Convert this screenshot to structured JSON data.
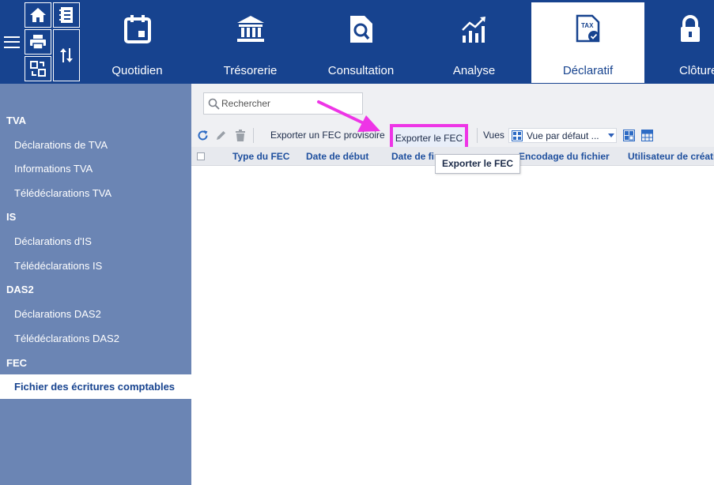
{
  "colors": {
    "topbar": "#17438f",
    "sidebar": "#6b85b4",
    "highlight": "#ee35e6",
    "header_text": "#1e4f9e"
  },
  "quick_access": [
    {
      "icon": "home-icon"
    },
    {
      "icon": "address-book-icon"
    },
    {
      "icon": "printer-icon"
    },
    {
      "icon": "sort-arrows-icon"
    },
    {
      "icon": "sync-icon"
    }
  ],
  "modules": [
    {
      "label": "Quotidien",
      "icon": "calendar-icon"
    },
    {
      "label": "Trésorerie",
      "icon": "bank-icon"
    },
    {
      "label": "Consultation",
      "icon": "document-search-icon"
    },
    {
      "label": "Analyse",
      "icon": "chart-icon"
    },
    {
      "label": "Déclaratif",
      "icon": "tax-document-icon",
      "active": true
    },
    {
      "label": "Clôture",
      "icon": "lock-icon"
    }
  ],
  "sidebar": {
    "sections": [
      {
        "title": "TVA",
        "items": [
          "Déclarations de TVA",
          "Informations TVA",
          "Télédéclarations TVA"
        ]
      },
      {
        "title": "IS",
        "items": [
          "Déclarations d'IS",
          "Télédéclarations IS"
        ]
      },
      {
        "title": "DAS2",
        "items": [
          "Déclarations DAS2",
          "Télédéclarations DAS2"
        ]
      },
      {
        "title": "FEC",
        "items": [
          "Fichier des écritures comptables"
        ],
        "active_item": "Fichier des écritures comptables"
      }
    ]
  },
  "search": {
    "placeholder": "Rechercher",
    "value": ""
  },
  "toolbar": {
    "export_provisional_label": "Exporter un FEC provisoire",
    "export_label": "Exporter le FEC",
    "views_label": "Vues",
    "view_selected": "Vue par défaut ..."
  },
  "grid": {
    "columns": [
      "Type du FEC",
      "Date de début",
      "Date de fin",
      "Encodage du fichier",
      "Utilisateur de création"
    ],
    "rows": []
  },
  "tooltip": {
    "text": "Exporter le FEC"
  }
}
